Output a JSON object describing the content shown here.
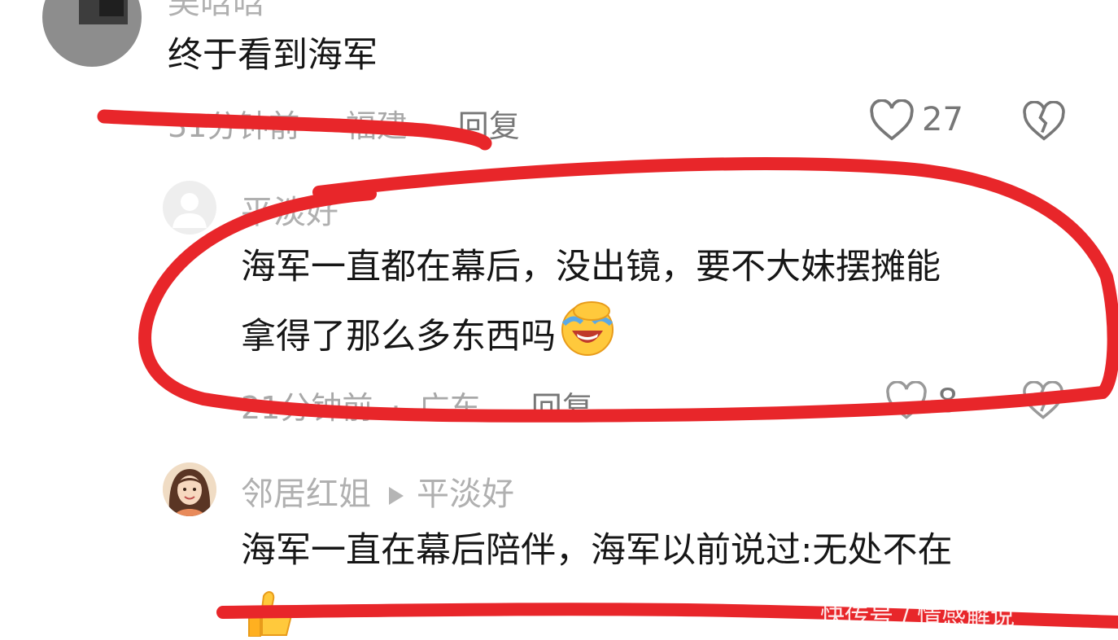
{
  "comments": [
    {
      "username": "吴晗晗",
      "text": "终于看到海军",
      "time": "31分钟前",
      "location": "福建",
      "reply_label": "回复",
      "likes": "27"
    },
    {
      "username": "平淡好",
      "text_line1": "海军一直都在幕后，没出镜，要不大妹摆摊能",
      "text_line2": "拿得了那么多东西吗",
      "time": "21分钟前",
      "location": "广东",
      "reply_label": "回复",
      "likes": "8"
    },
    {
      "username": "邻居红姐",
      "reply_to": "平淡好",
      "text": "海军一直在幕后陪伴，海军以前说过:无处不在"
    }
  ],
  "separator": "·",
  "watermark": "快传号 / 情感解说",
  "colors": {
    "annotation_red": "#e8262a",
    "text": "#161616",
    "muted": "#a8a8a8"
  },
  "icons": [
    "heart-outline-icon",
    "broken-heart-icon",
    "laugh-cry-emoji",
    "thumbs-up-emoji",
    "play-triangle-icon"
  ]
}
